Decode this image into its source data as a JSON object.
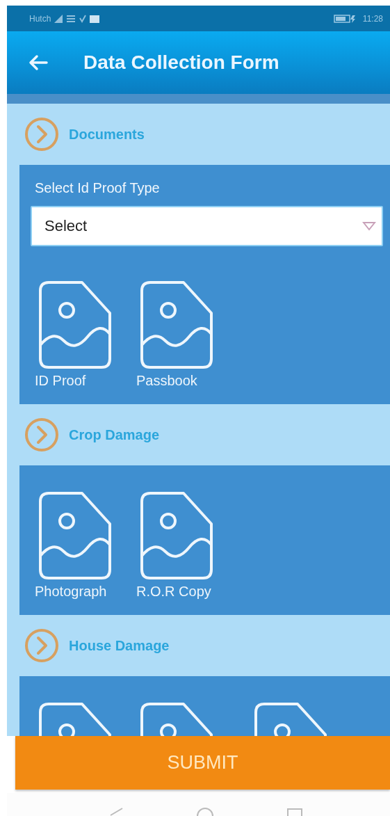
{
  "status_bar": {
    "carrier": "Hutch",
    "time": "11:28"
  },
  "app_bar": {
    "title": "Data Collection Form"
  },
  "sections": [
    {
      "title": "Documents",
      "field": {
        "label": "Select Id Proof Type",
        "value": "Select"
      },
      "uploads": [
        {
          "kind": "image",
          "label": "ID Proof"
        },
        {
          "kind": "image",
          "label": "Passbook"
        }
      ]
    },
    {
      "title": "Crop Damage",
      "uploads": [
        {
          "kind": "image",
          "label": "Photograph"
        },
        {
          "kind": "image",
          "label": "R.O.R Copy"
        }
      ]
    },
    {
      "title": "House Damage",
      "uploads": [
        {
          "kind": "image"
        },
        {
          "kind": "image"
        },
        {
          "kind": "image"
        }
      ]
    }
  ],
  "submit": {
    "label": "SUBMIT"
  }
}
